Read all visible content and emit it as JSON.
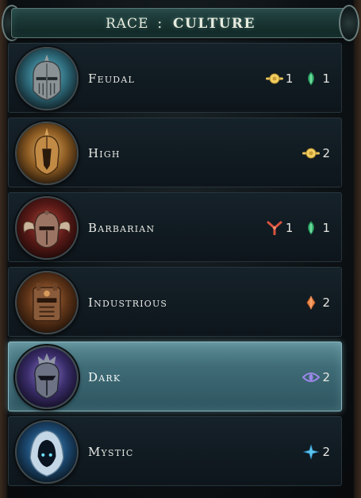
{
  "header": {
    "race_label": "RACE",
    "separator": ":",
    "culture_label": "CULTURE"
  },
  "cultures": [
    {
      "name": "Feudal",
      "emblem": "feudal-helmet-icon",
      "selected": false,
      "costs": [
        {
          "icon": "gold-coin-icon",
          "value": "1"
        },
        {
          "icon": "mana-leaf-icon",
          "value": "1"
        }
      ]
    },
    {
      "name": "High",
      "emblem": "high-helmet-icon",
      "selected": false,
      "costs": [
        {
          "icon": "gold-coin-icon",
          "value": "2"
        }
      ]
    },
    {
      "name": "Barbarian",
      "emblem": "barbarian-helmet-icon",
      "selected": false,
      "costs": [
        {
          "icon": "production-fork-icon",
          "value": "1"
        },
        {
          "icon": "mana-leaf-icon",
          "value": "1"
        }
      ]
    },
    {
      "name": "Industrious",
      "emblem": "industrious-helmet-icon",
      "selected": false,
      "costs": [
        {
          "icon": "orange-crystal-icon",
          "value": "2"
        }
      ]
    },
    {
      "name": "Dark",
      "emblem": "dark-helmet-icon",
      "selected": true,
      "costs": [
        {
          "icon": "purple-eye-icon",
          "value": "2"
        }
      ]
    },
    {
      "name": "Mystic",
      "emblem": "mystic-hood-icon",
      "selected": false,
      "costs": [
        {
          "icon": "blue-star-icon",
          "value": "2"
        }
      ]
    }
  ],
  "colors": {
    "gold": "#e8c25a",
    "mana_green": "#3fbf79",
    "production_red": "#d8533f",
    "crystal_orange": "#f08c4e",
    "eye_purple": "#9b87e8",
    "star_blue": "#5bc6f0",
    "selected_row": "#4a7c86"
  }
}
